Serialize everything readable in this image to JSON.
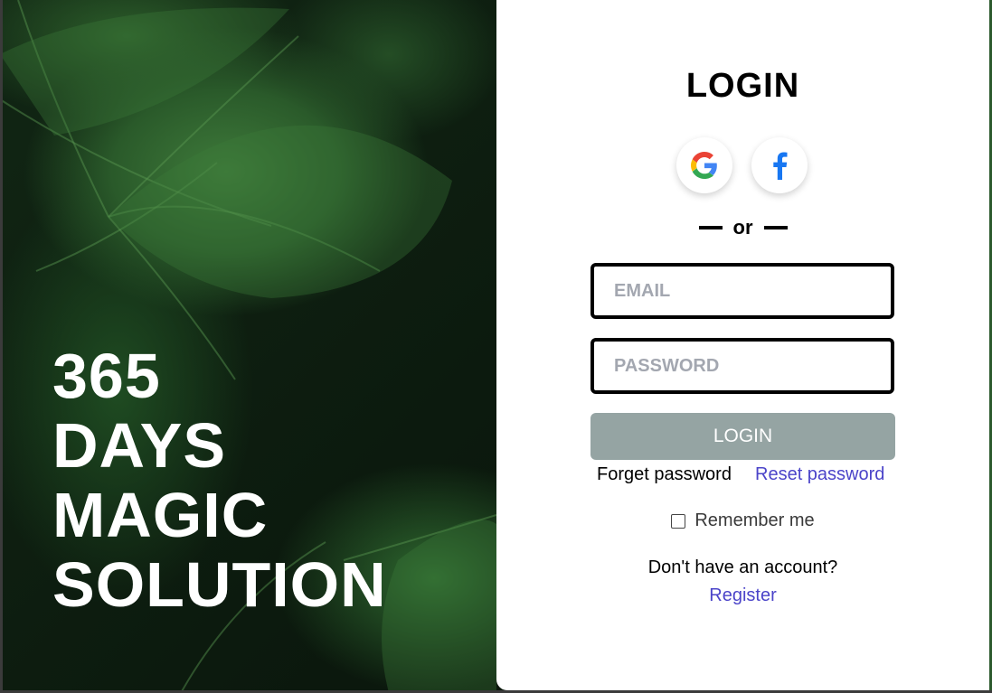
{
  "hero": {
    "lines": [
      "365",
      "DAYS",
      "MAGIC",
      "SOLUTION"
    ]
  },
  "login": {
    "title": "LOGIN",
    "social": [
      {
        "icon": "google-icon"
      },
      {
        "icon": "facebook-icon"
      }
    ],
    "divider_text": "or",
    "email_placeholder": "EMAIL",
    "password_placeholder": "PASSWORD",
    "submit_label": "LOGIN",
    "forget_label": "Forget password",
    "reset_label": "Reset password",
    "remember_label": "Remember me",
    "remember_checked": false,
    "no_account_text": "Don't have an account?",
    "register_label": "Register"
  },
  "colors": {
    "submit_bg": "#95a4a3",
    "link": "#4b44c9",
    "placeholder": "#a3a7b0",
    "facebook": "#1877f2"
  }
}
